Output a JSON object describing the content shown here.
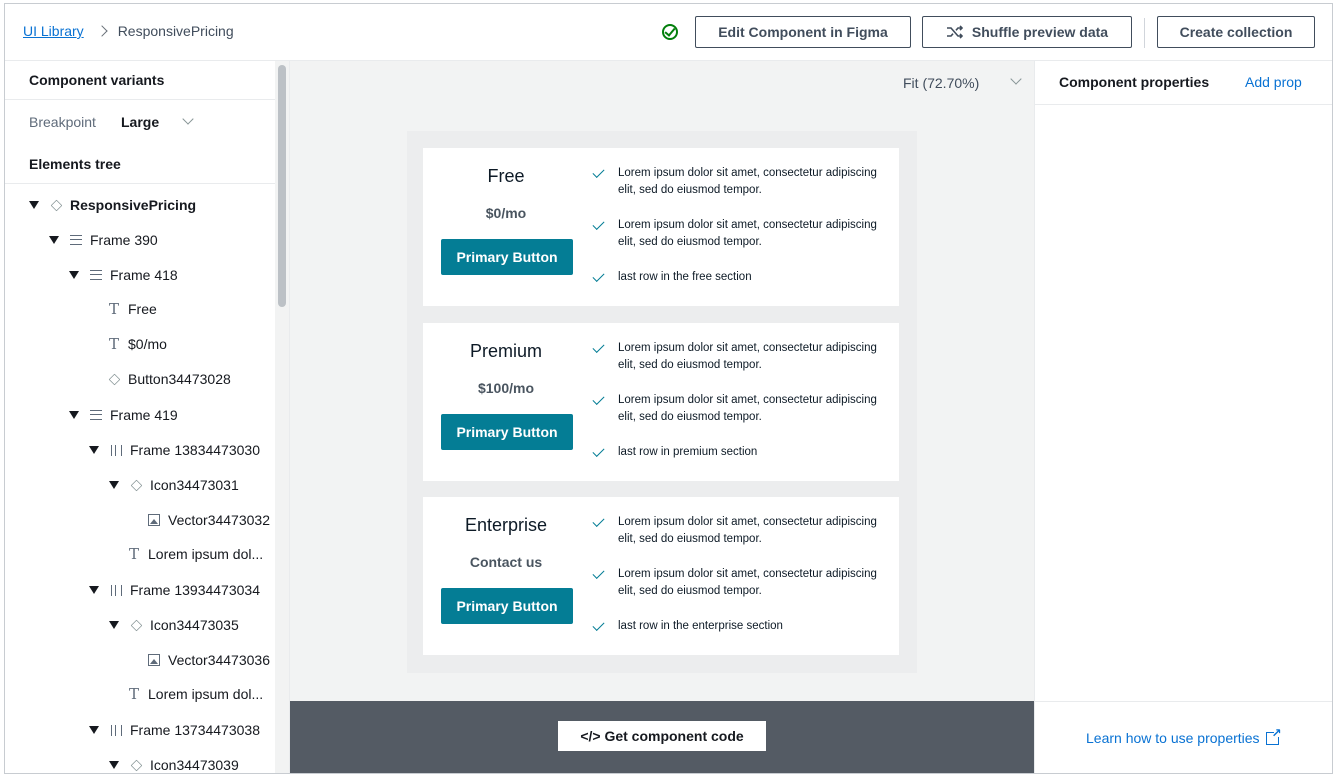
{
  "header": {
    "breadcrumb_root": "UI Library",
    "breadcrumb_current": "ResponsivePricing",
    "edit_button": "Edit Component in Figma",
    "shuffle_button": "Shuffle preview data",
    "collection_button": "Create collection"
  },
  "left": {
    "variants_title": "Component variants",
    "breakpoint_label": "Breakpoint",
    "breakpoint_value": "Large",
    "tree_title": "Elements tree",
    "tree": [
      {
        "label": "ResponsivePricing"
      },
      {
        "label": "Frame 390"
      },
      {
        "label": "Frame 418"
      },
      {
        "label": "Free"
      },
      {
        "label": "$0/mo"
      },
      {
        "label": "Button34473028"
      },
      {
        "label": "Frame 419"
      },
      {
        "label": "Frame 13834473030"
      },
      {
        "label": "Icon34473031"
      },
      {
        "label": "Vector34473032"
      },
      {
        "label": "Lorem ipsum dol..."
      },
      {
        "label": "Frame 13934473034"
      },
      {
        "label": "Icon34473035"
      },
      {
        "label": "Vector34473036"
      },
      {
        "label": "Lorem ipsum dol..."
      },
      {
        "label": "Frame 13734473038"
      },
      {
        "label": "Icon34473039"
      }
    ]
  },
  "canvas": {
    "zoom": "Fit (72.70%)",
    "cards": [
      {
        "title": "Free",
        "price": "$0/mo",
        "button": "Primary Button",
        "features": [
          "Lorem ipsum dolor sit amet, consectetur adipiscing elit, sed do eiusmod tempor.",
          "Lorem ipsum dolor sit amet, consectetur adipiscing elit, sed do eiusmod tempor.",
          "last row in the free section"
        ]
      },
      {
        "title": "Premium",
        "price": "$100/mo",
        "button": "Primary Button",
        "features": [
          "Lorem ipsum dolor sit amet, consectetur adipiscing elit, sed do eiusmod tempor.",
          "Lorem ipsum dolor sit amet, consectetur adipiscing elit, sed do eiusmod tempor.",
          "last row in premium section"
        ]
      },
      {
        "title": "Enterprise",
        "price": "Contact us",
        "button": "Primary Button",
        "features": [
          "Lorem ipsum dolor sit amet, consectetur adipiscing elit, sed do eiusmod tempor.",
          "Lorem ipsum dolor sit amet, consectetur adipiscing elit, sed do eiusmod tempor.",
          "last row in the enterprise section"
        ]
      }
    ],
    "code_button": "</> Get component code"
  },
  "right": {
    "title": "Component properties",
    "add_prop": "Add prop",
    "learn_link": "Learn how to use properties"
  },
  "colors": {
    "accent": "#047d95",
    "link": "#0972d3",
    "code_bar": "#545b64",
    "success": "#037f0c"
  }
}
